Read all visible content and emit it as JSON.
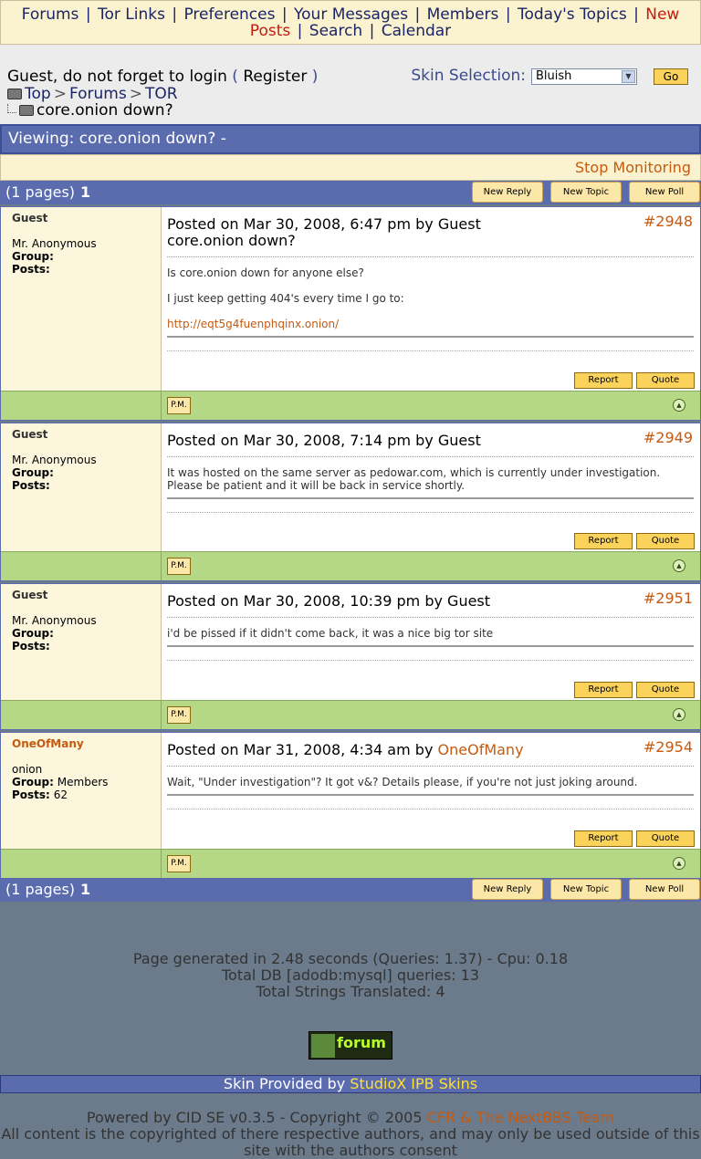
{
  "nav": {
    "items": [
      "Forums",
      "Tor Links",
      "Preferences",
      "Your Messages",
      "Members",
      "Today's Topics",
      "New",
      "Posts",
      "Search",
      "Calendar"
    ]
  },
  "info": {
    "guest_text": "Guest, do not forget to login",
    "open_paren": "(",
    "register": "Register",
    "close_paren": ")",
    "crumbs": [
      "Top",
      "Forums",
      "TOR"
    ],
    "current_topic": "core.onion down?",
    "skin_label": "Skin Selection:",
    "skin_value": "Bluish",
    "go_label": "Go"
  },
  "viewing": "Viewing: core.onion down? -",
  "stop_monitoring": "Stop Monitoring",
  "pagebar": {
    "pages": "(1 pages)",
    "current": "1",
    "new_reply": "New Reply",
    "new_topic": "New Topic",
    "new_poll": "New Poll"
  },
  "labels": {
    "group": "Group:",
    "posts": "Posts:",
    "report": "Report",
    "quote": "Quote",
    "pm": "P.M.",
    "posted_on": "Posted on",
    "by": "by"
  },
  "posts": [
    {
      "author": "Guest",
      "title": "Mr. Anonymous",
      "group": "",
      "posts": "",
      "date": "Mar 30, 2008, 6:47 pm",
      "id": "#2948",
      "subject": "core.onion down?",
      "lines": [
        "Is core.onion down for anyone else?",
        "I just keep getting 404's every time I go to:"
      ],
      "url": "http://eqt5g4fuenphqinx.onion/"
    },
    {
      "author": "Guest",
      "title": "Mr. Anonymous",
      "group": "",
      "posts": "",
      "date": "Mar 30, 2008, 7:14 pm",
      "id": "#2949",
      "lines": [
        "It was hosted on the same server as pedowar.com, which is currently under investigation. Please be patient and it will be back in service shortly."
      ]
    },
    {
      "author": "Guest",
      "title": "Mr. Anonymous",
      "group": "",
      "posts": "",
      "date": "Mar 30, 2008, 10:39 pm",
      "id": "#2951",
      "lines": [
        "i'd be pissed if it didn't come back, it was a nice big tor site"
      ]
    },
    {
      "author": "OneOfMany",
      "title": "onion",
      "group": "Members",
      "posts": "62",
      "date": "Mar 31, 2008, 4:34 am",
      "id": "#2954",
      "lines": [
        "Wait, \"Under investigation\"? It got v&? Details please, if you're not just joking around."
      ]
    }
  ],
  "stats": {
    "line1": "Page generated in 2.48 seconds (Queries: 1.37) - Cpu: 0.18",
    "line2": "Total DB [adodb:mysql] queries: 13",
    "line3": "Total Strings Translated: 4"
  },
  "logo_text": "forum",
  "skin_provided": {
    "text": "Skin Provided by",
    "link": "StudioX IPB Skins"
  },
  "copyright": {
    "powered": "Powered by CID SE v0.3.5 - Copyright © 2005",
    "team": "CFR & The NextBBS Team",
    "rest": "All content is the copyrighted of there respective authors, and may only be used outside of this site with the authors consent"
  },
  "colors": {
    "nav_bg": "#fbf3cf",
    "bar_blue": "#5a6bae",
    "link_orange": "#c55a10",
    "foot_green": "#b5d887",
    "page_bg": "#6b7b8c"
  }
}
